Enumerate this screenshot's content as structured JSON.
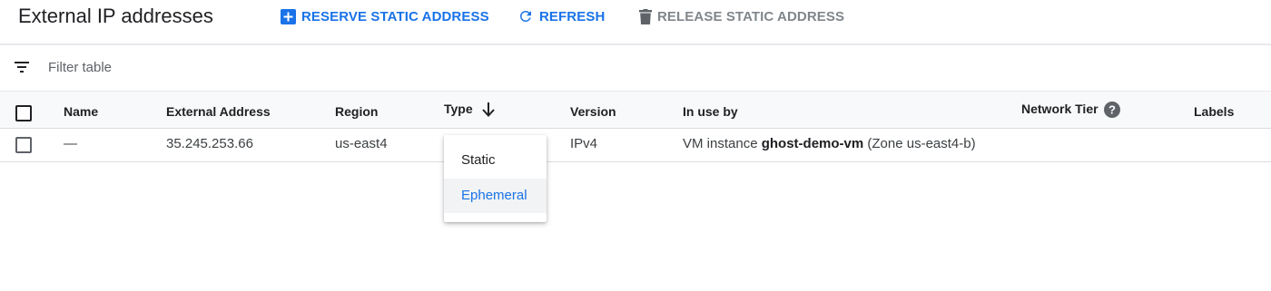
{
  "header": {
    "title": "External IP addresses",
    "actions": {
      "reserve": "RESERVE STATIC ADDRESS",
      "refresh": "REFRESH",
      "release": "RELEASE STATIC ADDRESS"
    }
  },
  "filter": {
    "placeholder": "Filter table"
  },
  "table": {
    "columns": [
      "Name",
      "External Address",
      "Region",
      "Type",
      "Version",
      "In use by",
      "Network Tier",
      "Labels"
    ],
    "sorted_column": "Type",
    "sort_direction": "descending",
    "rows": [
      {
        "name": "—",
        "external_address": "35.245.253.66",
        "region": "us-east4",
        "version": "IPv4",
        "in_use_by": {
          "prefix": "VM instance ",
          "instance": "ghost-demo-vm",
          "suffix": " (Zone us-east4-b)"
        }
      }
    ]
  },
  "type_dropdown": {
    "options": [
      "Static",
      "Ephemeral"
    ],
    "highlighted": "Ephemeral"
  },
  "colors": {
    "accent": "#1a73e8",
    "disabled": "#80868b",
    "header_bg": "#f8f9fa",
    "highlight_bg": "#f1f3f4"
  },
  "icons": {
    "reserve": "add-box-icon",
    "refresh": "refresh-icon",
    "release": "trash-icon",
    "filter": "filter-list-icon",
    "sort": "arrow-down-icon",
    "help": "help-circle-icon"
  }
}
